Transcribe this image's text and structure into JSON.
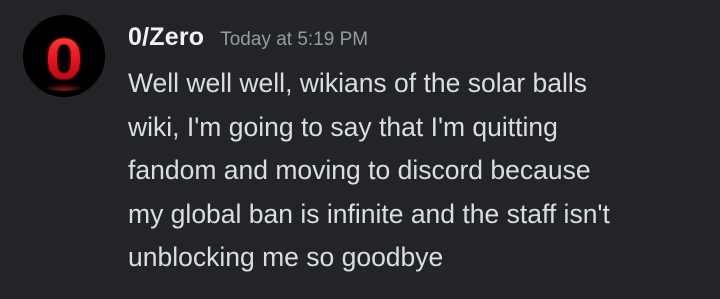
{
  "message": {
    "author": {
      "username": "0/Zero",
      "avatar_icon": "red-zero-logo-icon",
      "avatar_glyph": "0"
    },
    "timestamp": "Today at 5:19 PM",
    "content_lines": [
      "Well well well, wikians of the solar balls",
      "wiki, I'm going to say that I'm quitting",
      "fandom and moving to discord because",
      "my global ban is infinite and the staff isn't",
      "unblocking me so goodbye"
    ]
  },
  "colors": {
    "background": "#232428",
    "username": "#f2f3f5",
    "timestamp": "#949ba4",
    "text": "#dbdee1",
    "avatar_accent": "#e0141e"
  }
}
